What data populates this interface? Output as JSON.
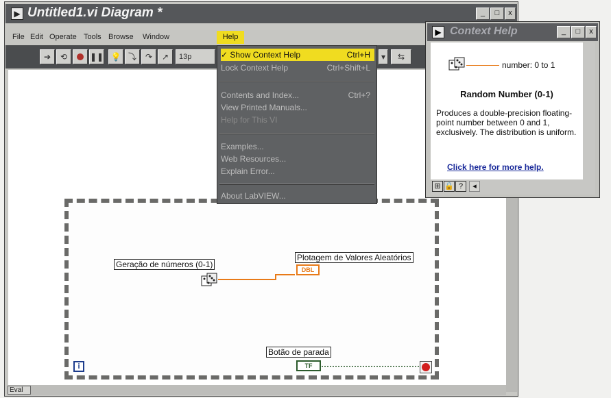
{
  "window": {
    "title": "Untitled1.vi Diagram *",
    "min_glyph": "_",
    "max_glyph": "□",
    "close_glyph": "x"
  },
  "menubar": {
    "file": "File",
    "edit": "Edit",
    "operate": "Operate",
    "tools": "Tools",
    "browse": "Browse",
    "window": "Window",
    "help": "Help"
  },
  "toolbar": {
    "font_value": "13p"
  },
  "help_menu": {
    "items": [
      {
        "label": "✓ Show Context Help",
        "shortcut": "Ctrl+H"
      },
      {
        "label": "Lock Context Help",
        "shortcut": "Ctrl+Shift+L"
      },
      {
        "label": "Contents and Index...",
        "shortcut": "Ctrl+?"
      },
      {
        "label": "View Printed Manuals...",
        "shortcut": ""
      },
      {
        "label": "Help for This VI",
        "shortcut": ""
      },
      {
        "label": "Examples...",
        "shortcut": ""
      },
      {
        "label": "Web Resources...",
        "shortcut": ""
      },
      {
        "label": "Explain Error...",
        "shortcut": ""
      },
      {
        "label": "About LabVIEW...",
        "shortcut": ""
      }
    ]
  },
  "diagram": {
    "random_label": "Geração de números (0-1)",
    "plot_label": "Plotagem de Valores Aleatórios",
    "stop_label": "Botão de parada",
    "dbl_terminal": "DBL",
    "tf_terminal": "TF",
    "iteration_terminal": "i"
  },
  "statusbar": {
    "eval": "Eval"
  },
  "context_help": {
    "title": "Context Help",
    "connector_text": "number: 0 to 1",
    "function_name": "Random Number (0-1)",
    "description": "Produces a double-precision floating-point number between 0 and 1, exclusively. The distribution is uniform.",
    "link": "Click here for more help."
  },
  "colors": {
    "menu_highlight": "#f0dc20",
    "numeric_wire": "#e87a18",
    "boolean_wire": "#2b5a2b",
    "link_blue": "#1a2a9a"
  }
}
